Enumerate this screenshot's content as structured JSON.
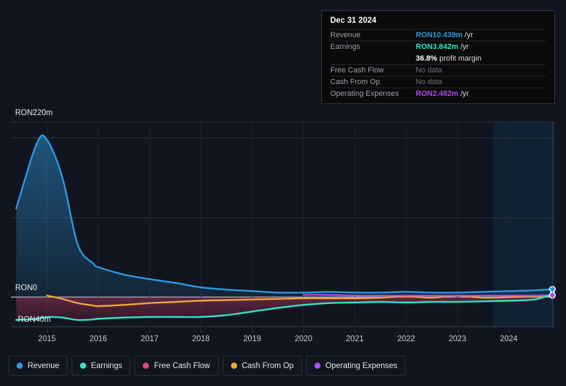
{
  "tooltip": {
    "date": "Dec 31 2024",
    "rows": [
      {
        "label": "Revenue",
        "value": "RON10.439m",
        "unit": "/yr",
        "color": "#2f9ae0",
        "nodata": false
      },
      {
        "label": "Earnings",
        "value": "RON3.842m",
        "unit": "/yr",
        "color": "#2ee6c5",
        "nodata": false
      },
      {
        "label": "",
        "value": "36.8%",
        "unit": "profit margin",
        "color": "#ffffff",
        "nodata": false
      },
      {
        "label": "Free Cash Flow",
        "value": "No data",
        "unit": "",
        "color": "#6b7280",
        "nodata": true
      },
      {
        "label": "Cash From Op",
        "value": "No data",
        "unit": "",
        "color": "#6b7280",
        "nodata": true
      },
      {
        "label": "Operating Expenses",
        "value": "RON2.482m",
        "unit": "/yr",
        "color": "#b44bf0",
        "nodata": false
      }
    ]
  },
  "axis": {
    "y_top": "RON220m",
    "y_zero": "RON0",
    "y_neg": "-RON40m",
    "x_ticks": [
      "2015",
      "2016",
      "2017",
      "2018",
      "2019",
      "2020",
      "2021",
      "2022",
      "2023",
      "2024"
    ]
  },
  "legend": [
    {
      "label": "Revenue",
      "color": "#2f9ae0"
    },
    {
      "label": "Earnings",
      "color": "#2ee6c5"
    },
    {
      "label": "Free Cash Flow",
      "color": "#e0487f"
    },
    {
      "label": "Cash From Op",
      "color": "#efa83c"
    },
    {
      "label": "Operating Expenses",
      "color": "#b44bf0"
    }
  ],
  "chart_data": {
    "type": "line",
    "title": "",
    "xlabel": "",
    "ylabel": "RON",
    "currency": "RON",
    "units": "millions",
    "ylim": [
      -40,
      220
    ],
    "y_ticks": [
      -40,
      0,
      220
    ],
    "grid": true,
    "legend_position": "bottom",
    "x_range": [
      2014.3,
      2024.9
    ],
    "highlight_region": {
      "from": 2023.7,
      "to": 2024.9
    },
    "x": [
      2014.4,
      2014.8,
      2015.0,
      2015.3,
      2015.6,
      2015.9,
      2016.0,
      2016.5,
      2017.0,
      2017.5,
      2018.0,
      2018.5,
      2019.0,
      2019.5,
      2020.0,
      2020.5,
      2021.0,
      2021.5,
      2022.0,
      2022.5,
      2023.0,
      2023.5,
      2024.0,
      2024.5,
      2024.85
    ],
    "series": [
      {
        "name": "Revenue",
        "color": "#2f9ae0",
        "filled": true,
        "values": [
          118,
          205,
          210,
          160,
          70,
          45,
          40,
          30,
          24,
          19,
          13,
          10,
          8,
          6,
          6,
          7,
          6,
          6,
          7,
          6,
          6,
          7,
          8,
          9,
          10.439
        ]
      },
      {
        "name": "Earnings",
        "color": "#2ee6c5",
        "filled": true,
        "values": [
          -38,
          -36,
          -33,
          -34,
          -38,
          -37,
          -36,
          -34,
          -33,
          -33,
          -33,
          -30,
          -24,
          -18,
          -13,
          -10,
          -9,
          -8,
          -9,
          -8,
          -8,
          -7,
          -6,
          -4,
          3.842
        ]
      },
      {
        "name": "Free Cash Flow",
        "color": "#e0487f",
        "filled": false,
        "values": [
          null,
          null,
          null,
          null,
          null,
          null,
          null,
          null,
          null,
          null,
          null,
          null,
          null,
          null,
          null,
          null,
          null,
          null,
          null,
          null,
          null,
          null,
          null,
          null,
          null
        ]
      },
      {
        "name": "Cash From Op",
        "color": "#efa83c",
        "filled": false,
        "values": [
          null,
          null,
          2,
          -3,
          -10,
          -14,
          -15,
          -13,
          -10,
          -8,
          -6,
          -5,
          -4,
          -3,
          -2,
          -2,
          -2,
          -1,
          1,
          -1,
          2,
          -1,
          0,
          1,
          1
        ]
      },
      {
        "name": "Operating Expenses",
        "color": "#b44bf0",
        "filled": false,
        "values": [
          null,
          null,
          null,
          null,
          null,
          null,
          null,
          null,
          null,
          null,
          null,
          null,
          null,
          null,
          3,
          3,
          2,
          2,
          2,
          2,
          2,
          2,
          2,
          2,
          2.482
        ]
      }
    ],
    "endpoints": [
      {
        "series": "Revenue",
        "x": 2024.85,
        "y": 10.439,
        "color": "#2f9ae0"
      },
      {
        "series": "Operating Expenses",
        "x": 2024.85,
        "y": 2.482,
        "color": "#b44bf0"
      }
    ]
  }
}
